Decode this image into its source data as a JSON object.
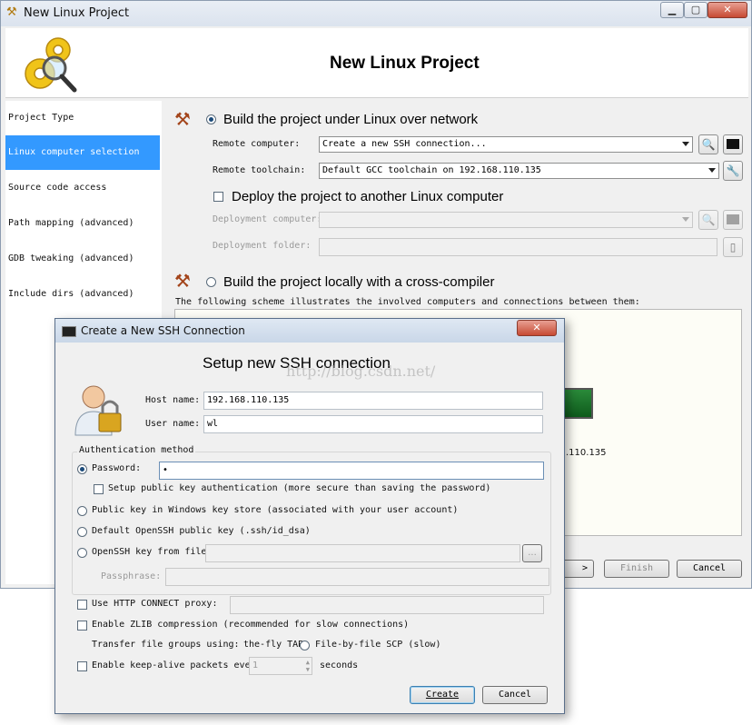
{
  "window": {
    "title": "New Linux Project"
  },
  "banner": {
    "heading": "New Linux Project"
  },
  "sidebar": {
    "items": [
      {
        "label": "Project Type"
      },
      {
        "label": "Linux computer selection"
      },
      {
        "label": "Source code access"
      },
      {
        "label": "Path mapping (advanced)"
      },
      {
        "label": "GDB tweaking (advanced)"
      },
      {
        "label": "Include dirs (advanced)"
      }
    ]
  },
  "network": {
    "radio_label": "Build the project under Linux over network",
    "remote_computer_label": "Remote computer:",
    "remote_computer_value": "Create a new SSH connection...",
    "remote_toolchain_label": "Remote toolchain:",
    "remote_toolchain_value": "Default GCC toolchain on 192.168.110.135",
    "deploy_label": "Deploy the project to another Linux computer",
    "deployment_computer_label": "Deployment computer:",
    "deployment_folder_label": "Deployment folder:"
  },
  "local": {
    "radio_label": "Build the project locally with a cross-compiler",
    "scheme_text": "The following scheme illustrates the involved computers and connections between them:",
    "scheme_ip_fragment": ".110.135"
  },
  "footer": {
    "next_fragment": ">",
    "finish_label": "Finish",
    "cancel_label": "Cancel"
  },
  "dialog": {
    "title": "Create a New SSH Connection",
    "heading": "Setup new SSH connection",
    "watermark": "http://blog.csdn.net/",
    "host_label": "Host name:",
    "host_value": "192.168.110.135",
    "user_label": "User name:",
    "user_value": "wl",
    "auth_group_label": "Authentication method",
    "password_label": "Password:",
    "password_value": "•",
    "setup_pubkey_label": "Setup public key authentication (more secure than saving the password)",
    "winkey_label": "Public key in Windows key store (associated with your user account)",
    "openssh_default_label": "Default OpenSSH public key (.ssh/id_dsa)",
    "openssh_file_label": "OpenSSH key from file:",
    "browse_label": "...",
    "passphrase_label": "Passphrase:",
    "http_proxy_label": "Use HTTP CONNECT proxy:",
    "zlib_label": "Enable ZLIB compression (recommended for slow connections)",
    "transfer_label": "Transfer file groups using:",
    "transfer_option1": "the-fly TAR",
    "transfer_option2": "File-by-file SCP (slow)",
    "keepalive_label": "Enable keep-alive packets eve",
    "keepalive_value": "1",
    "seconds_label": "seconds",
    "create_label": "Create",
    "cancel_label": "Cancel"
  }
}
